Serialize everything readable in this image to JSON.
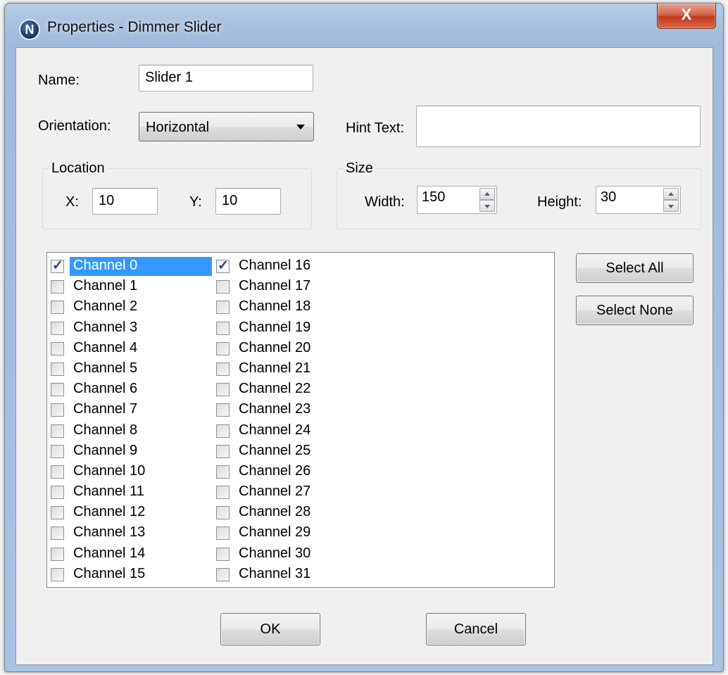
{
  "window": {
    "app_icon": "N",
    "title": "Properties - Dimmer Slider",
    "close_label": "X"
  },
  "name": {
    "label": "Name:",
    "value": "Slider 1"
  },
  "orientation": {
    "label": "Orientation:",
    "value": "Horizontal"
  },
  "hint_text": {
    "label": "Hint Text:",
    "value": ""
  },
  "location": {
    "title": "Location",
    "x_label": "X:",
    "x_value": "10",
    "y_label": "Y:",
    "y_value": "10"
  },
  "size": {
    "title": "Size",
    "width_label": "Width:",
    "width_value": "150",
    "height_label": "Height:",
    "height_value": "30"
  },
  "channels": {
    "col1": [
      {
        "label": "Channel 0",
        "checked": true,
        "selected": true
      },
      {
        "label": "Channel 1",
        "checked": false
      },
      {
        "label": "Channel 2",
        "checked": false
      },
      {
        "label": "Channel 3",
        "checked": false
      },
      {
        "label": "Channel 4",
        "checked": false
      },
      {
        "label": "Channel 5",
        "checked": false
      },
      {
        "label": "Channel 6",
        "checked": false
      },
      {
        "label": "Channel 7",
        "checked": false
      },
      {
        "label": "Channel 8",
        "checked": false
      },
      {
        "label": "Channel 9",
        "checked": false
      },
      {
        "label": "Channel 10",
        "checked": false
      },
      {
        "label": "Channel 11",
        "checked": false
      },
      {
        "label": "Channel 12",
        "checked": false
      },
      {
        "label": "Channel 13",
        "checked": false
      },
      {
        "label": "Channel 14",
        "checked": false
      },
      {
        "label": "Channel 15",
        "checked": false
      }
    ],
    "col2": [
      {
        "label": "Channel 16",
        "checked": true
      },
      {
        "label": "Channel 17",
        "checked": false
      },
      {
        "label": "Channel 18",
        "checked": false
      },
      {
        "label": "Channel 19",
        "checked": false
      },
      {
        "label": "Channel 20",
        "checked": false
      },
      {
        "label": "Channel 21",
        "checked": false
      },
      {
        "label": "Channel 22",
        "checked": false
      },
      {
        "label": "Channel 23",
        "checked": false
      },
      {
        "label": "Channel 24",
        "checked": false
      },
      {
        "label": "Channel 25",
        "checked": false
      },
      {
        "label": "Channel 26",
        "checked": false
      },
      {
        "label": "Channel 27",
        "checked": false
      },
      {
        "label": "Channel 28",
        "checked": false
      },
      {
        "label": "Channel 29",
        "checked": false
      },
      {
        "label": "Channel 30",
        "checked": false
      },
      {
        "label": "Channel 31",
        "checked": false
      }
    ]
  },
  "buttons": {
    "select_all": "Select All",
    "select_none": "Select None",
    "ok": "OK",
    "cancel": "Cancel"
  },
  "colors": {
    "selection": "#3399ff",
    "close_button": "#c1391d",
    "dialog_face": "#f0f0f0"
  }
}
